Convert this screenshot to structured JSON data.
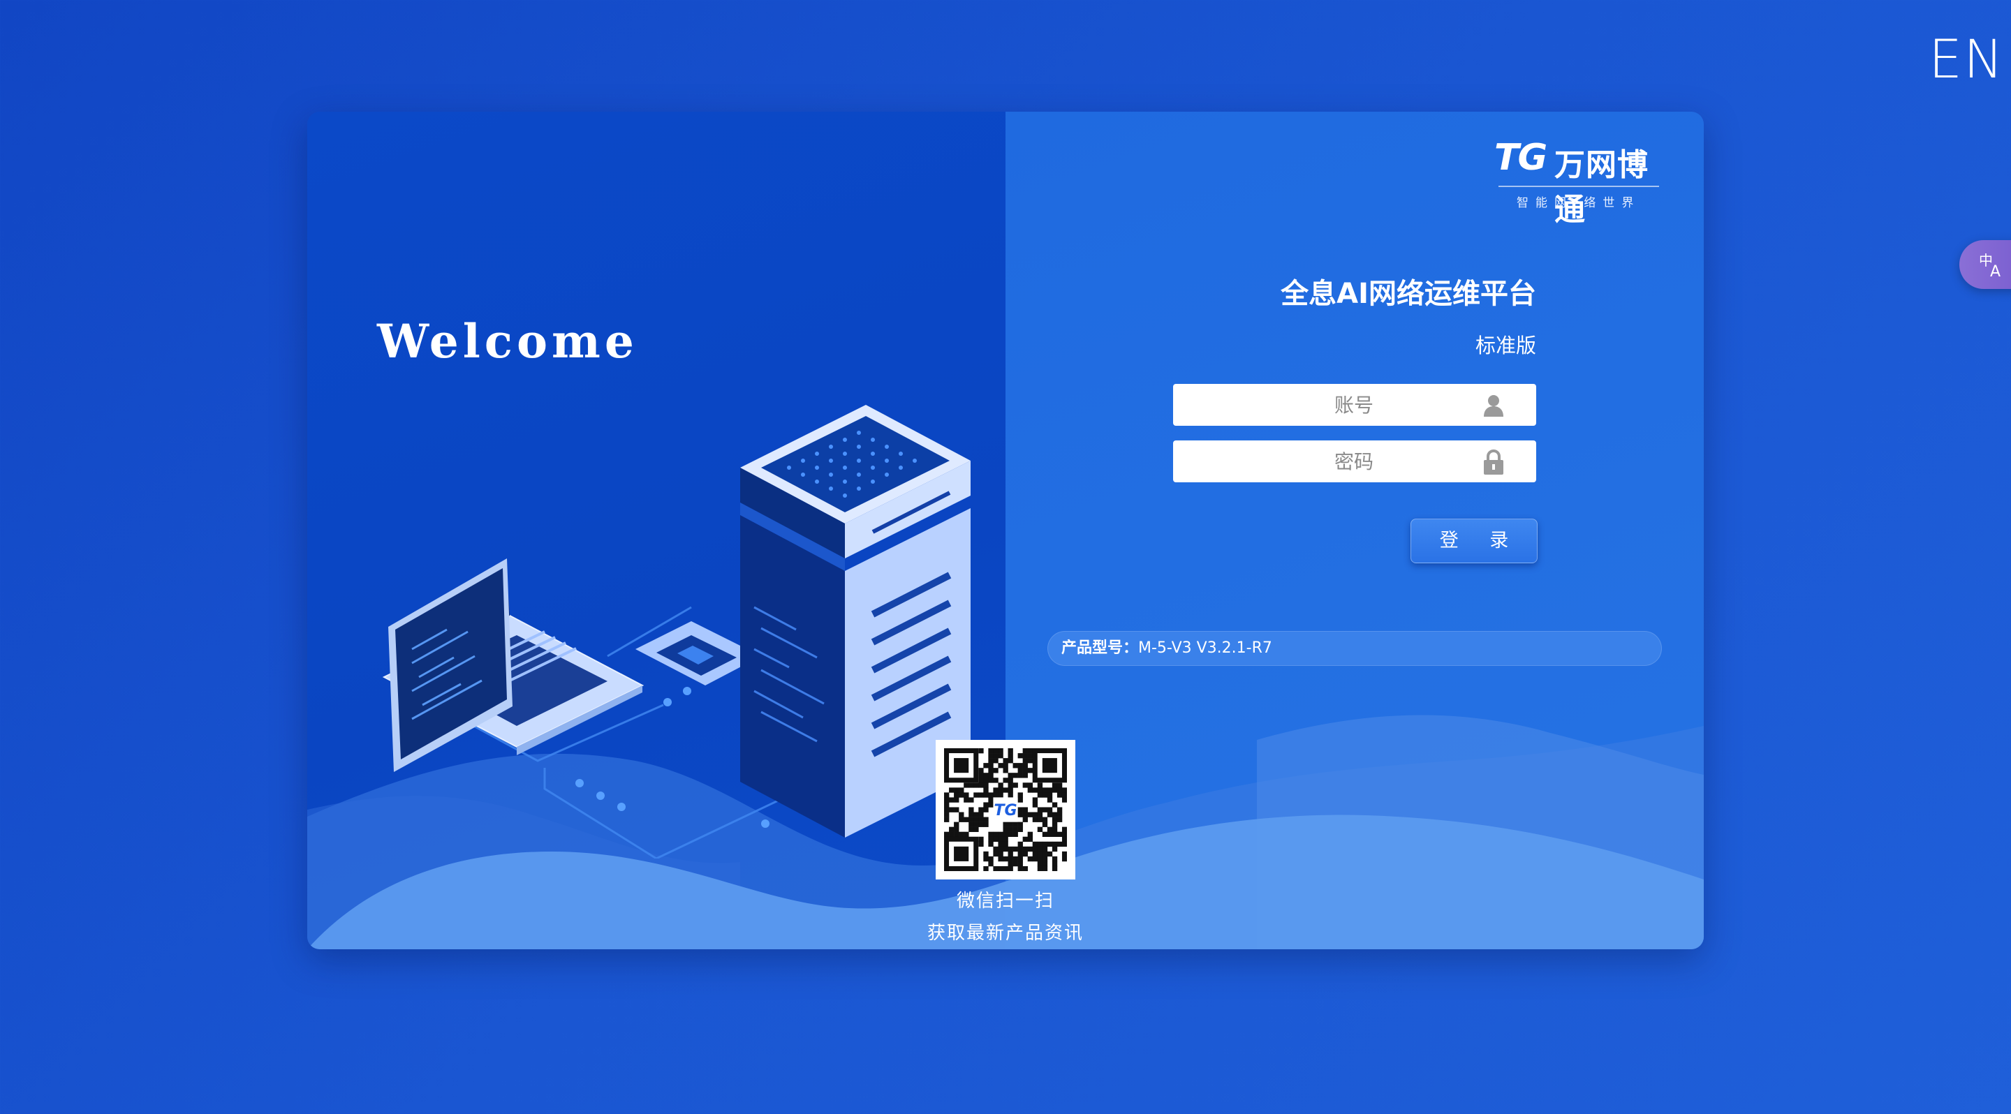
{
  "lang_switch": "EN",
  "translate_fab": {
    "icon": "translate-icon"
  },
  "left": {
    "welcome": "Welcome"
  },
  "brand": {
    "mark": "TG",
    "name": "万网博通",
    "slogan": "智能网·络世界"
  },
  "login": {
    "title": "全息AI网络运维平台",
    "edition": "标准版",
    "account_placeholder": "账号",
    "password_placeholder": "密码",
    "submit_label": "登 录"
  },
  "product": {
    "label": "产品型号：",
    "model": "M-5-V3 V3.2.1-R7"
  },
  "qr": {
    "caption1": "微信扫一扫",
    "caption2": "获取最新产品资讯",
    "logo_text": "TG"
  },
  "colors": {
    "background": "#1a56d2",
    "left_panel": "#0b49c8",
    "right_panel": "#2270e2",
    "button": "#3580ec",
    "fab": "#8a6fd6"
  }
}
